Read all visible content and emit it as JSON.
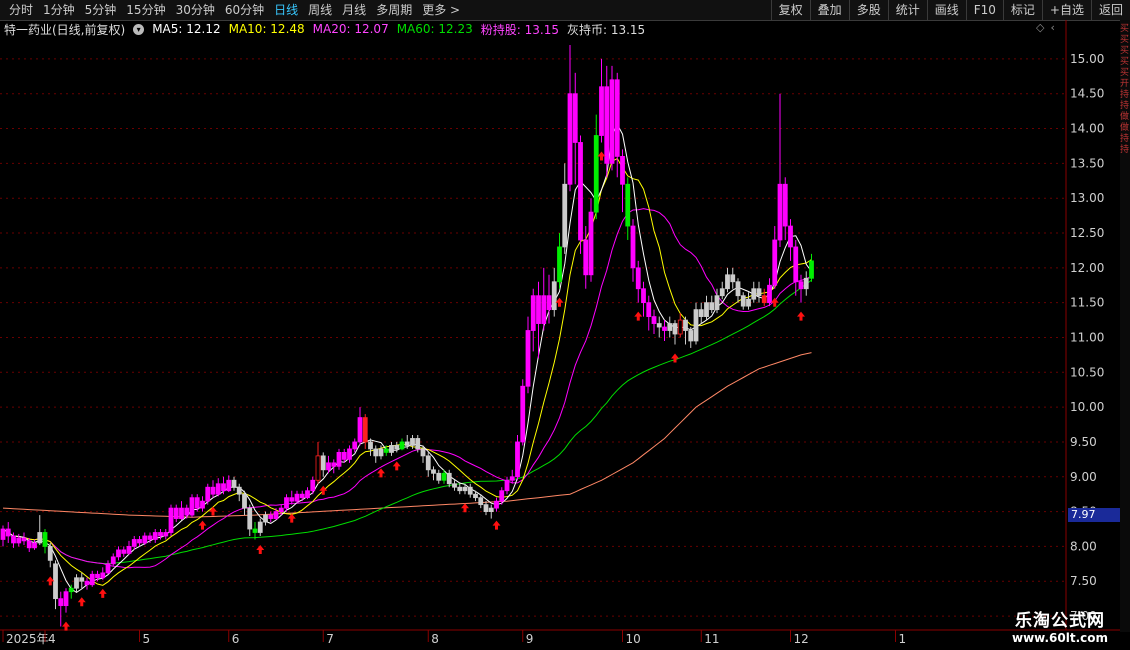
{
  "toolbar_top": {
    "periods": [
      {
        "label": "分时",
        "active": false
      },
      {
        "label": "1分钟",
        "active": false
      },
      {
        "label": "5分钟",
        "active": false
      },
      {
        "label": "15分钟",
        "active": false
      },
      {
        "label": "30分钟",
        "active": false
      },
      {
        "label": "60分钟",
        "active": false
      },
      {
        "label": "日线",
        "active": true
      },
      {
        "label": "周线",
        "active": false
      },
      {
        "label": "月线",
        "active": false
      },
      {
        "label": "多周期",
        "active": false
      },
      {
        "label": "更多 >",
        "active": false
      }
    ],
    "buttons": [
      "复权",
      "叠加",
      "多股",
      "统计",
      "画线",
      "F10",
      "标记",
      "+自选",
      "返回"
    ]
  },
  "info": {
    "stock": "特一药业(日线,前复权)",
    "ma5": "MA5: 12.12",
    "ma10": "MA10: 12.48",
    "ma20": "MA20: 12.07",
    "ma60": "MA60: 12.23",
    "pink_hold": "粉持股: 13.15",
    "gray_hold": "灰持币: 13.15"
  },
  "current_price_label": "7.97",
  "side_strip_text": "买买买买买开持持做做持持",
  "watermark": {
    "title": "乐淘公式网",
    "url": "www.60lt.com"
  },
  "colors": {
    "up": "#ff2020",
    "down": "#00ee00",
    "hold": "#ff00ff",
    "cash": "#cccccc",
    "ma5": "#ffffff",
    "ma10": "#ffff00",
    "ma20": "#ff00ff",
    "ma60": "#00dd00",
    "ma_long": "#ff8866",
    "grid": "#6a0000",
    "axis_text": "#d0d0d0"
  },
  "chart_data": {
    "type": "candlestick",
    "ylim": [
      6.8,
      15.3
    ],
    "y_ticks": [
      7.0,
      7.5,
      8.0,
      8.5,
      9.0,
      9.5,
      10.0,
      10.5,
      11.0,
      11.5,
      12.0,
      12.5,
      13.0,
      13.5,
      14.0,
      14.5,
      15.0
    ],
    "x_ticks": [
      {
        "i": 0,
        "label": "2025年"
      },
      {
        "i": 8,
        "label": "4"
      },
      {
        "i": 26,
        "label": "5"
      },
      {
        "i": 43,
        "label": "6"
      },
      {
        "i": 61,
        "label": "7"
      },
      {
        "i": 81,
        "label": "8"
      },
      {
        "i": 99,
        "label": "9"
      },
      {
        "i": 118,
        "label": "10"
      },
      {
        "i": 133,
        "label": "11"
      },
      {
        "i": 150,
        "label": "12"
      },
      {
        "i": 170,
        "label": "1"
      }
    ],
    "candles": [
      [
        8.1,
        8.25,
        8.3,
        8.0
      ],
      [
        8.25,
        8.15,
        8.35,
        8.05
      ],
      [
        8.15,
        8.05,
        8.2,
        7.98
      ],
      [
        8.05,
        8.12,
        8.18,
        8.0
      ],
      [
        8.12,
        8.08,
        8.2,
        8.02
      ],
      [
        8.08,
        7.98,
        8.12,
        7.92
      ],
      [
        7.98,
        8.05,
        8.1,
        7.95
      ],
      [
        8.05,
        8.2,
        8.45,
        8.02
      ],
      [
        8.2,
        8.0,
        8.25,
        7.9
      ],
      [
        8.0,
        7.8,
        8.05,
        7.7
      ],
      [
        7.75,
        7.25,
        7.8,
        7.1
      ],
      [
        7.25,
        7.15,
        7.35,
        6.85
      ],
      [
        7.15,
        7.35,
        7.4,
        7.05
      ],
      [
        7.35,
        7.4,
        7.45,
        7.25
      ],
      [
        7.4,
        7.55,
        7.6,
        7.35
      ],
      [
        7.55,
        7.5,
        7.62,
        7.4
      ],
      [
        7.5,
        7.45,
        7.55,
        7.38
      ],
      [
        7.45,
        7.6,
        7.65,
        7.42
      ],
      [
        7.6,
        7.55,
        7.65,
        7.5
      ],
      [
        7.55,
        7.62,
        7.7,
        7.52
      ],
      [
        7.62,
        7.75,
        7.8,
        7.6
      ],
      [
        7.75,
        7.85,
        7.9,
        7.72
      ],
      [
        7.85,
        7.95,
        8.0,
        7.8
      ],
      [
        7.95,
        7.9,
        8.0,
        7.85
      ],
      [
        7.9,
        8.0,
        8.08,
        7.88
      ],
      [
        8.0,
        8.1,
        8.15,
        7.95
      ],
      [
        8.1,
        8.05,
        8.15,
        8.0
      ],
      [
        8.05,
        8.15,
        8.2,
        8.02
      ],
      [
        8.15,
        8.1,
        8.2,
        8.05
      ],
      [
        8.1,
        8.2,
        8.25,
        8.05
      ],
      [
        8.2,
        8.15,
        8.25,
        8.1
      ],
      [
        8.15,
        8.2,
        8.25,
        8.1
      ],
      [
        8.2,
        8.55,
        8.6,
        8.15
      ],
      [
        8.55,
        8.4,
        8.6,
        8.35
      ],
      [
        8.4,
        8.55,
        8.65,
        8.38
      ],
      [
        8.55,
        8.45,
        8.6,
        8.4
      ],
      [
        8.45,
        8.7,
        8.75,
        8.42
      ],
      [
        8.7,
        8.55,
        8.75,
        8.5
      ],
      [
        8.55,
        8.65,
        8.72,
        8.5
      ],
      [
        8.65,
        8.85,
        8.9,
        8.6
      ],
      [
        8.85,
        8.75,
        8.95,
        8.7
      ],
      [
        8.75,
        8.9,
        8.98,
        8.72
      ],
      [
        8.9,
        8.8,
        9.0,
        8.75
      ],
      [
        8.8,
        8.95,
        9.02,
        8.78
      ],
      [
        8.95,
        8.85,
        9.0,
        8.8
      ],
      [
        8.85,
        8.75,
        8.9,
        8.65
      ],
      [
        8.75,
        8.55,
        8.8,
        8.45
      ],
      [
        8.55,
        8.25,
        8.6,
        8.15
      ],
      [
        8.25,
        8.2,
        8.35,
        8.1
      ],
      [
        8.2,
        8.35,
        8.4,
        8.15
      ],
      [
        8.35,
        8.45,
        8.5,
        8.3
      ],
      [
        8.45,
        8.4,
        8.5,
        8.35
      ],
      [
        8.4,
        8.5,
        8.55,
        8.38
      ],
      [
        8.5,
        8.55,
        8.6,
        8.45
      ],
      [
        8.55,
        8.7,
        8.75,
        8.5
      ],
      [
        8.7,
        8.65,
        8.8,
        8.6
      ],
      [
        8.65,
        8.75,
        8.8,
        8.62
      ],
      [
        8.75,
        8.7,
        8.8,
        8.65
      ],
      [
        8.7,
        8.8,
        8.85,
        8.68
      ],
      [
        8.8,
        8.95,
        9.0,
        8.75
      ],
      [
        8.95,
        9.3,
        9.5,
        8.9
      ],
      [
        9.3,
        9.1,
        9.35,
        9.0
      ],
      [
        9.1,
        9.2,
        9.3,
        9.05
      ],
      [
        9.2,
        9.15,
        9.25,
        9.05
      ],
      [
        9.15,
        9.35,
        9.4,
        9.1
      ],
      [
        9.35,
        9.25,
        9.4,
        9.2
      ],
      [
        9.25,
        9.4,
        9.45,
        9.2
      ],
      [
        9.4,
        9.5,
        9.55,
        9.35
      ],
      [
        9.5,
        9.85,
        10.0,
        9.45
      ],
      [
        9.85,
        9.5,
        9.9,
        9.4
      ],
      [
        9.5,
        9.4,
        9.55,
        9.3
      ],
      [
        9.4,
        9.3,
        9.45,
        9.2
      ],
      [
        9.3,
        9.4,
        9.45,
        9.25
      ],
      [
        9.4,
        9.35,
        9.45,
        9.3
      ],
      [
        9.35,
        9.45,
        9.5,
        9.3
      ],
      [
        9.45,
        9.4,
        9.5,
        9.35
      ],
      [
        9.4,
        9.5,
        9.55,
        9.38
      ],
      [
        9.5,
        9.45,
        9.6,
        9.4
      ],
      [
        9.45,
        9.55,
        9.6,
        9.4
      ],
      [
        9.55,
        9.4,
        9.6,
        9.35
      ],
      [
        9.4,
        9.3,
        9.45,
        9.2
      ],
      [
        9.3,
        9.1,
        9.35,
        9.0
      ],
      [
        9.1,
        9.05,
        9.15,
        8.95
      ],
      [
        9.05,
        8.95,
        9.1,
        8.9
      ],
      [
        8.95,
        9.05,
        9.1,
        8.9
      ],
      [
        9.05,
        8.9,
        9.1,
        8.85
      ],
      [
        8.9,
        8.85,
        8.95,
        8.8
      ],
      [
        8.85,
        8.8,
        8.9,
        8.75
      ],
      [
        8.8,
        8.85,
        8.9,
        8.75
      ],
      [
        8.85,
        8.75,
        8.9,
        8.7
      ],
      [
        8.75,
        8.7,
        8.8,
        8.65
      ],
      [
        8.7,
        8.6,
        8.75,
        8.55
      ],
      [
        8.6,
        8.5,
        8.65,
        8.45
      ],
      [
        8.5,
        8.55,
        8.6,
        8.4
      ],
      [
        8.55,
        8.65,
        8.7,
        8.5
      ],
      [
        8.65,
        8.8,
        8.85,
        8.6
      ],
      [
        8.8,
        8.95,
        9.0,
        8.75
      ],
      [
        8.95,
        9.0,
        9.1,
        8.9
      ],
      [
        9.0,
        9.5,
        9.6,
        8.95
      ],
      [
        9.5,
        10.3,
        10.4,
        9.45
      ],
      [
        10.3,
        11.1,
        11.3,
        10.2
      ],
      [
        11.1,
        11.6,
        11.7,
        10.8
      ],
      [
        11.6,
        11.2,
        11.8,
        10.7
      ],
      [
        11.2,
        11.6,
        12.0,
        11.1
      ],
      [
        11.6,
        11.4,
        11.9,
        11.2
      ],
      [
        11.4,
        11.8,
        12.0,
        11.3
      ],
      [
        11.8,
        12.3,
        12.5,
        11.7
      ],
      [
        12.3,
        13.2,
        13.5,
        12.2
      ],
      [
        13.2,
        14.5,
        15.2,
        13.1
      ],
      [
        14.5,
        13.8,
        14.8,
        13.2
      ],
      [
        13.8,
        12.4,
        13.9,
        12.2
      ],
      [
        12.4,
        11.9,
        12.6,
        11.7
      ],
      [
        11.9,
        12.8,
        13.0,
        11.8
      ],
      [
        12.8,
        13.9,
        14.2,
        12.7
      ],
      [
        13.9,
        14.6,
        15.0,
        13.8
      ],
      [
        14.6,
        13.5,
        14.9,
        13.3
      ],
      [
        13.5,
        14.7,
        14.9,
        13.4
      ],
      [
        14.7,
        13.6,
        14.8,
        13.3
      ],
      [
        13.6,
        13.2,
        13.7,
        12.8
      ],
      [
        13.2,
        12.6,
        13.3,
        12.4
      ],
      [
        12.6,
        12.0,
        12.7,
        11.8
      ],
      [
        12.0,
        11.7,
        12.1,
        11.5
      ],
      [
        11.7,
        11.5,
        11.8,
        11.3
      ],
      [
        11.5,
        11.3,
        11.6,
        11.1
      ],
      [
        11.3,
        11.2,
        11.4,
        11.05
      ],
      [
        11.2,
        11.15,
        11.3,
        11.0
      ],
      [
        11.15,
        11.1,
        11.25,
        10.95
      ],
      [
        11.1,
        11.2,
        11.3,
        11.0
      ],
      [
        11.2,
        11.05,
        11.25,
        10.9
      ],
      [
        11.05,
        11.25,
        11.35,
        11.0
      ],
      [
        11.25,
        11.1,
        11.3,
        10.9
      ],
      [
        11.1,
        10.95,
        11.15,
        10.85
      ],
      [
        10.95,
        11.4,
        11.5,
        10.9
      ],
      [
        11.4,
        11.3,
        11.5,
        11.2
      ],
      [
        11.3,
        11.5,
        11.6,
        11.25
      ],
      [
        11.5,
        11.4,
        11.6,
        11.35
      ],
      [
        11.4,
        11.6,
        11.7,
        11.35
      ],
      [
        11.6,
        11.7,
        11.8,
        11.55
      ],
      [
        11.7,
        11.9,
        12.0,
        11.65
      ],
      [
        11.9,
        11.8,
        12.0,
        11.7
      ],
      [
        11.8,
        11.6,
        11.85,
        11.5
      ],
      [
        11.6,
        11.45,
        11.65,
        11.4
      ],
      [
        11.45,
        11.55,
        11.65,
        11.4
      ],
      [
        11.55,
        11.7,
        11.8,
        11.5
      ],
      [
        11.7,
        11.6,
        11.8,
        11.5
      ],
      [
        11.6,
        11.5,
        11.7,
        11.45
      ],
      [
        11.5,
        11.75,
        11.85,
        11.45
      ],
      [
        11.75,
        12.4,
        12.6,
        11.7
      ],
      [
        12.4,
        13.2,
        14.5,
        12.3
      ],
      [
        13.2,
        12.6,
        13.3,
        12.4
      ],
      [
        12.6,
        12.3,
        12.7,
        12.1
      ],
      [
        12.3,
        11.8,
        12.4,
        11.6
      ],
      [
        11.8,
        11.7,
        11.9,
        11.5
      ],
      [
        11.7,
        11.85,
        11.95,
        11.6
      ],
      [
        11.85,
        12.1,
        12.2,
        11.8
      ]
    ],
    "signal_types": "HHHHHHHCDCCHHDCCHHHHHHHHHHHHHHHHHHHHHHHHHHHHCCCCDCCHHHHHHHHHUCHHHHHHHUCCCDCCDCCCCCCCDCCCCCCCCCHHHHHHHHHHHCDCHHHHHDHHHHHDHHHHHCHCCUCCCCCCCCCCCCCCCUHHHHHHHCDCCHHHHDHHCCCC",
    "up_arrows": [
      9,
      12,
      15,
      19,
      38,
      40,
      49,
      55,
      61,
      72,
      75,
      88,
      94,
      106,
      114,
      121,
      128,
      147,
      152,
      171,
      176,
      184,
      186,
      196
    ],
    "ma_long_values": [
      8.55,
      8.5,
      8.45,
      8.42,
      8.45,
      8.5,
      8.55,
      8.6,
      8.65,
      8.75,
      8.95,
      9.2,
      9.55,
      10.0,
      10.3,
      10.55,
      10.75,
      10.95,
      11.1
    ],
    "ma_long_index": [
      0,
      12,
      24,
      36,
      48,
      60,
      72,
      84,
      96,
      108,
      114,
      120,
      126,
      132,
      138,
      144,
      152,
      164,
      182
    ],
    "legend": [
      "MA5",
      "MA10",
      "MA20",
      "MA60",
      "粉持股",
      "灰持币"
    ]
  }
}
